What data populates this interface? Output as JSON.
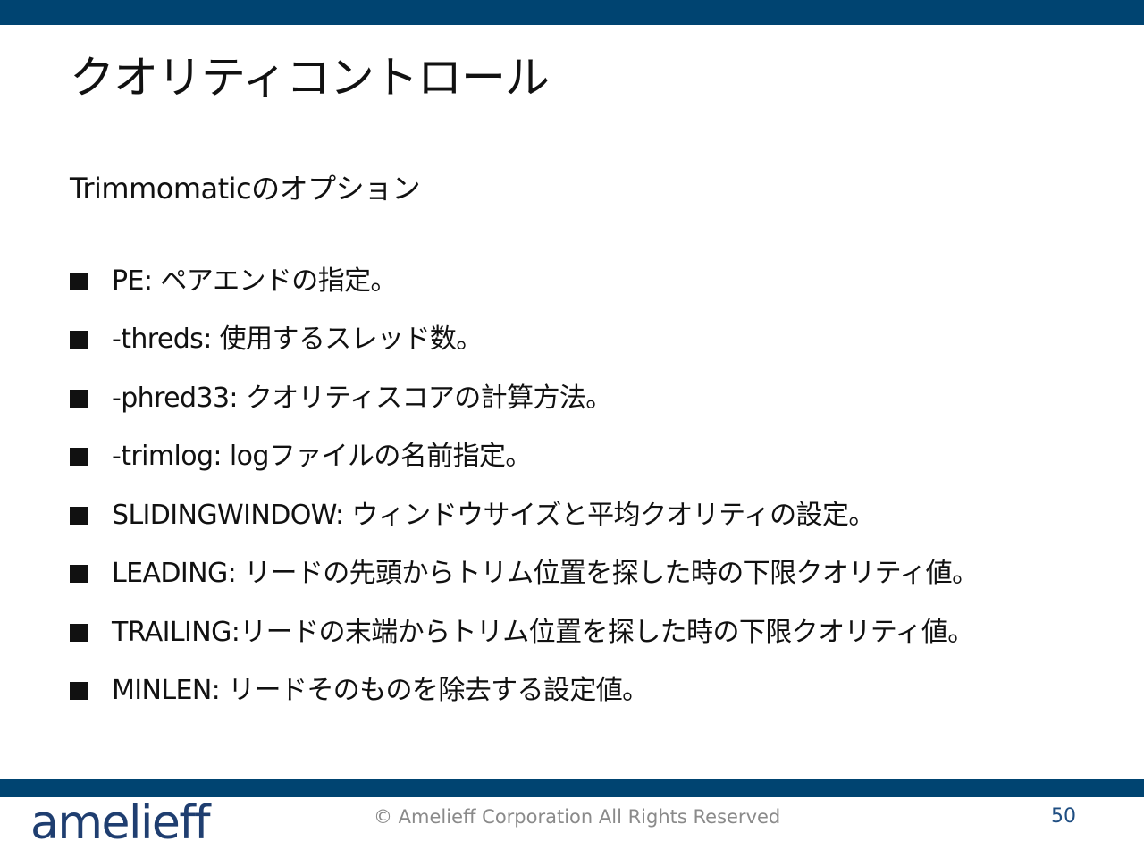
{
  "slide": {
    "title": "クオリティコントロール",
    "subtitle": "Trimmomaticのオプション",
    "bullets": [
      "PE: ペアエンドの指定。",
      "-threds: 使用するスレッド数。",
      "-phred33: クオリティスコアの計算方法。",
      "-trimlog: logファイルの名前指定。",
      "SLIDINGWINDOW: ウィンドウサイズと平均クオリティの設定。",
      "LEADING: リードの先頭からトリム位置を探した時の下限クオリティ値。",
      "TRAILING:リードの末端からトリム位置を探した時の下限クオリティ値。",
      "MINLEN: リードそのものを除去する設定値。"
    ]
  },
  "footer": {
    "logo": "amelieff",
    "copyright": "© Amelieff Corporation All Rights Reserved",
    "page_number": "50"
  },
  "colors": {
    "brand_bar": "#004471",
    "logo": "#1f3e70",
    "page_number": "#1f4e82",
    "copyright": "#8a8a8a"
  }
}
